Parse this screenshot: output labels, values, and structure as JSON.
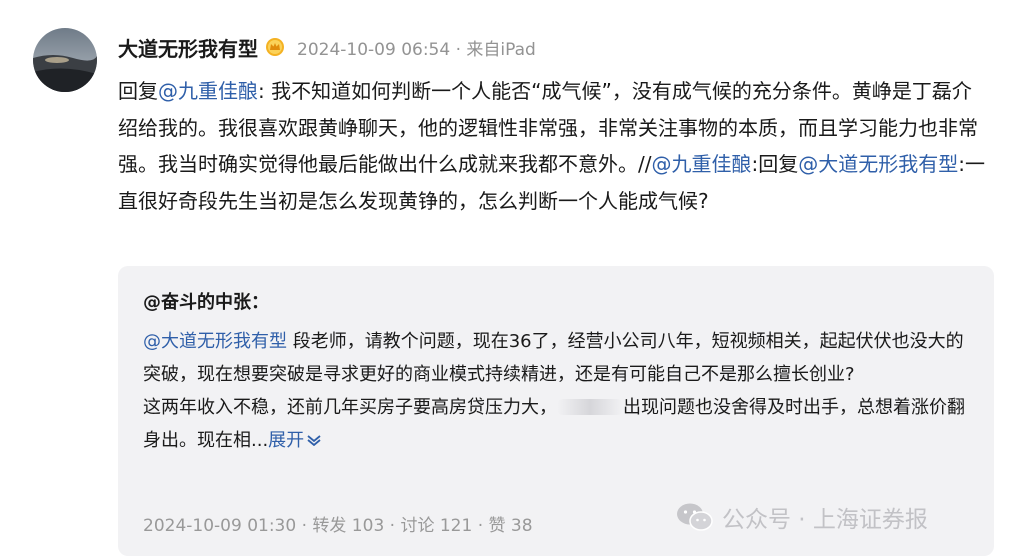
{
  "post": {
    "username": "大道无形我有型",
    "verified_badge_icon": "gold-crown-badge-icon",
    "meta": "2024-10-09 06:54 · 来自iPad",
    "reply_prefix": "回复",
    "mention1": "@九重佳酿",
    "text1": ": 我不知道如何判断一个人能否“成气候”，没有成气候的充分条件。黄峥是丁磊介绍给我的。我很喜欢跟黄峥聊天，他的逻辑性非常强，非常关注事物的本质，而且学习能力也非常强。我当时确实觉得他最后能做出什么成就来我都不意外。//",
    "mention2": "@九重佳酿",
    "text2": ":回复",
    "mention3": "@大道无形我有型",
    "text3": ":一直很好奇段先生当初是怎么发现黄铮的，怎么判断一个人能成气候?"
  },
  "quoted": {
    "author": "@奋斗的中张",
    "author_suffix": "：",
    "mention": "@大道无形我有型",
    "text1": " 段老师，请教个问题，现在36了，经营小公司八年，短视频相关，起起伏伏也没大的突破，现在想要突破是寻求更好的商业模式持续精进，还是有可能自己不是那么擅长创业?",
    "text2a": "这两年收入不稳，还前几年买房子要高房贷压力大，",
    "text2b": "出现问题也没舍得及时出手，总想着涨价翻身出。现在相...",
    "expand_label": "展开",
    "expand_icon": "chevron-down-icon",
    "footer": "2024-10-09 01:30 · 转发 103 · 讨论 121 · 赞 38"
  },
  "watermark": {
    "icon": "wechat-icon",
    "text": "公众号 · 上海证券报"
  }
}
